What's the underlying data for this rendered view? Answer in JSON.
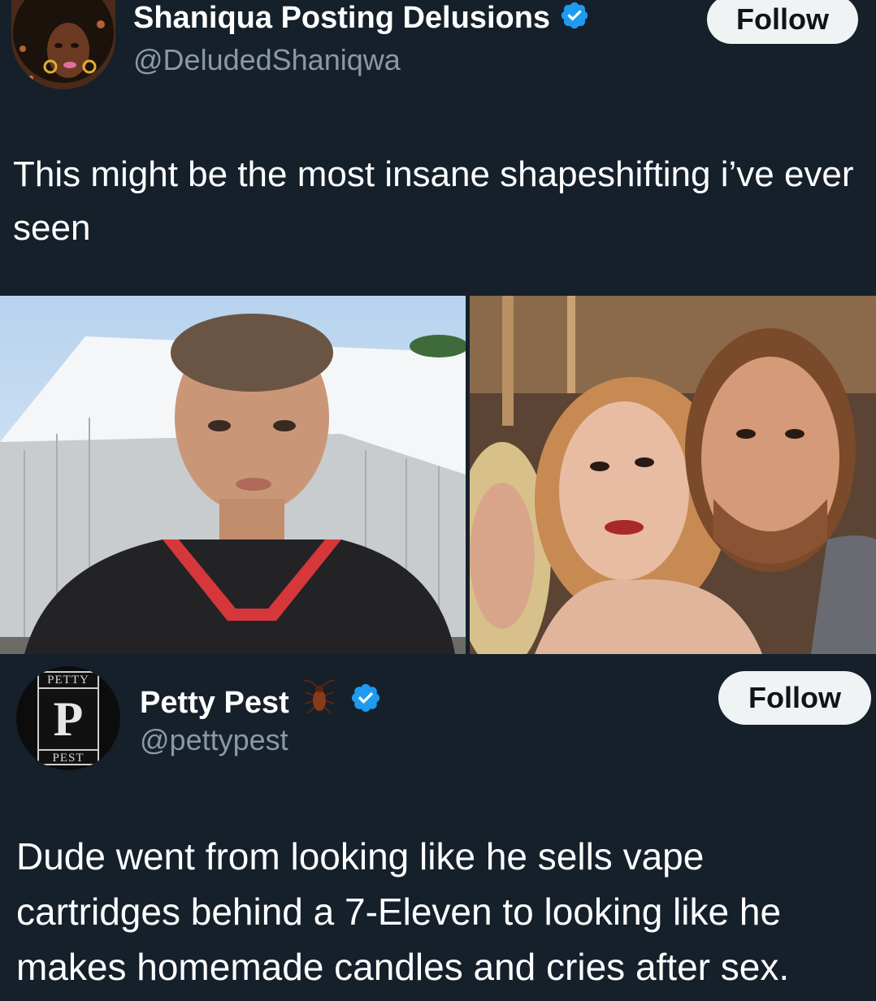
{
  "tweet1": {
    "name": "Shaniqua Posting Delusions",
    "handle": "@DeludedShaniqwa",
    "follow_label": "Follow",
    "text": "This might be the most insane shapeshifting i’ve ever seen",
    "verified_icon": "verified-badge-icon",
    "avatar_icon": "woman-illustration-avatar"
  },
  "photos": {
    "left": "man-in-jersey-photo",
    "right": "couple-selfie-photo"
  },
  "tweet2": {
    "name": "Petty Pest",
    "handle": "@pettypest",
    "follow_label": "Follow",
    "emoji_icon": "cockroach-icon",
    "verified_icon": "verified-badge-icon",
    "avatar": {
      "top": "PETTY",
      "bottom": "PEST",
      "monogram": "P"
    },
    "text": "Dude went from looking like he sells vape cartridges behind a 7-Eleven to looking like he makes homemade candles and cries after sex."
  },
  "colors": {
    "background": "#15202b",
    "handle": "#8b98a5",
    "verified": "#1d9bf0",
    "follow_bg": "#eff3f4"
  }
}
